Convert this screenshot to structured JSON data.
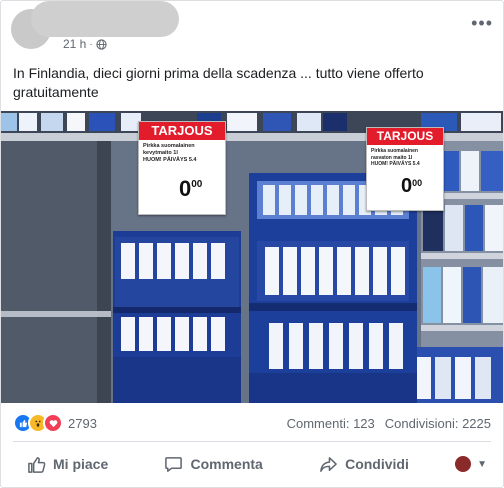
{
  "post": {
    "time": "21 h",
    "separator": "·",
    "text": "In Finlandia, dieci giorni prima della scadenza ... tutto viene offerto gratuitamente",
    "more_icon": "ellipsis-icon",
    "audience_icon": "globe-icon"
  },
  "photo": {
    "sign_left": {
      "title": "TARJOUS",
      "line1": "Pirkka suomalainen",
      "line2": "kevytmaito 1l",
      "line3": "HUOM! PÄIVÄYS 5.4",
      "price": "0",
      "cents": "00"
    },
    "sign_right": {
      "title": "TARJOUS",
      "line1": "Pirkka suomalainen",
      "line2": "rasvaton maito 1l",
      "line3": "HUOM! PÄIVÄYS 5.4",
      "price": "0",
      "cents": "00"
    },
    "colors": {
      "sign_red": "#e31c2b",
      "crate_blue": "#1f3f9a",
      "shelf_bg": "#6b7788"
    }
  },
  "engagement": {
    "reaction_count": "2793",
    "comments": "Commenti: 123",
    "shares": "Condivisioni: 2225",
    "reactions": [
      "like-icon",
      "wow-icon",
      "love-icon"
    ]
  },
  "actions": {
    "like": "Mi piace",
    "comment": "Commenta",
    "share": "Condividi"
  }
}
